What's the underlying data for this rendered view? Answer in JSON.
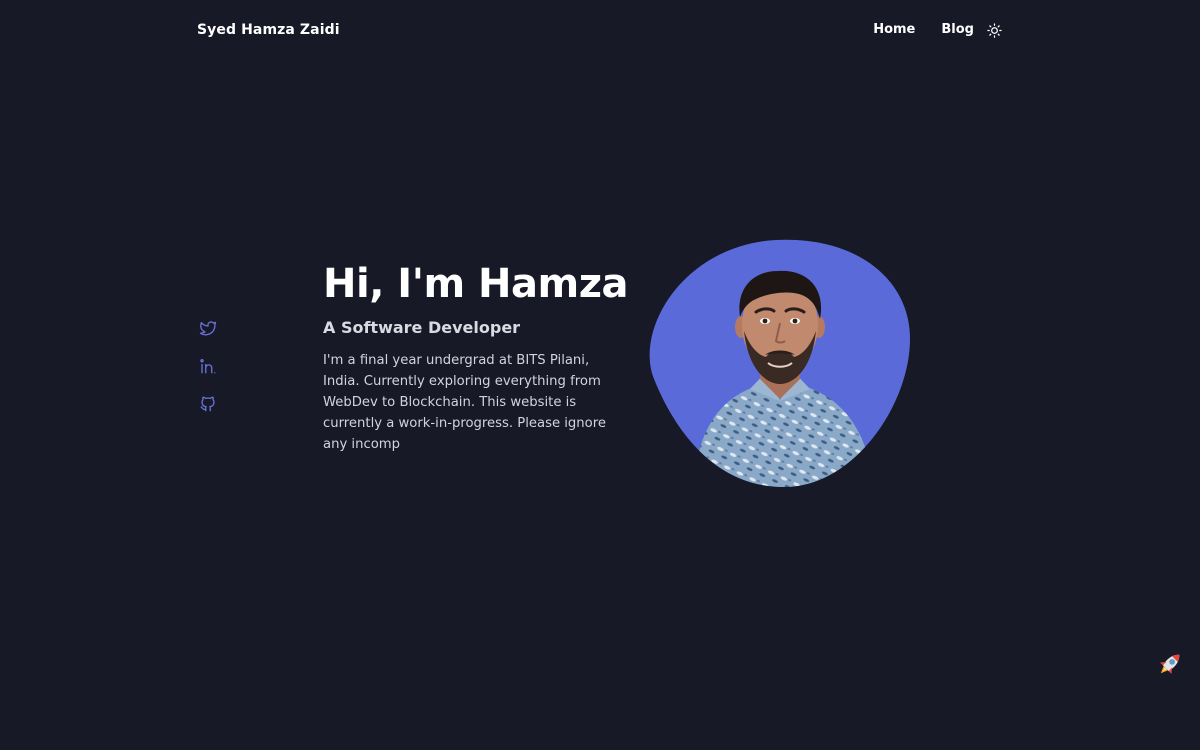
{
  "header": {
    "brand": "Syed Hamza Zaidi",
    "nav": {
      "home": "Home",
      "blog": "Blog"
    },
    "theme_icon": "sun-icon"
  },
  "social": [
    {
      "name": "twitter",
      "icon": "twitter-icon"
    },
    {
      "name": "linkedin",
      "icon": "linkedin-icon"
    },
    {
      "name": "github",
      "icon": "github-icon"
    }
  ],
  "hero": {
    "title": "Hi, I'm Hamza",
    "subtitle": "A Software Developer",
    "description": "I'm a final year undergrad at BITS Pilani, India. Currently exploring everything from WebDev to Blockchain. This website is currently a work-in-progress. Please ignore any incomp"
  },
  "colors": {
    "background": "#171926",
    "accent": "#5b6ad9",
    "icon_accent": "#6872d8",
    "text": "#ffffff"
  },
  "scroll_top_icon": "rocket-icon"
}
